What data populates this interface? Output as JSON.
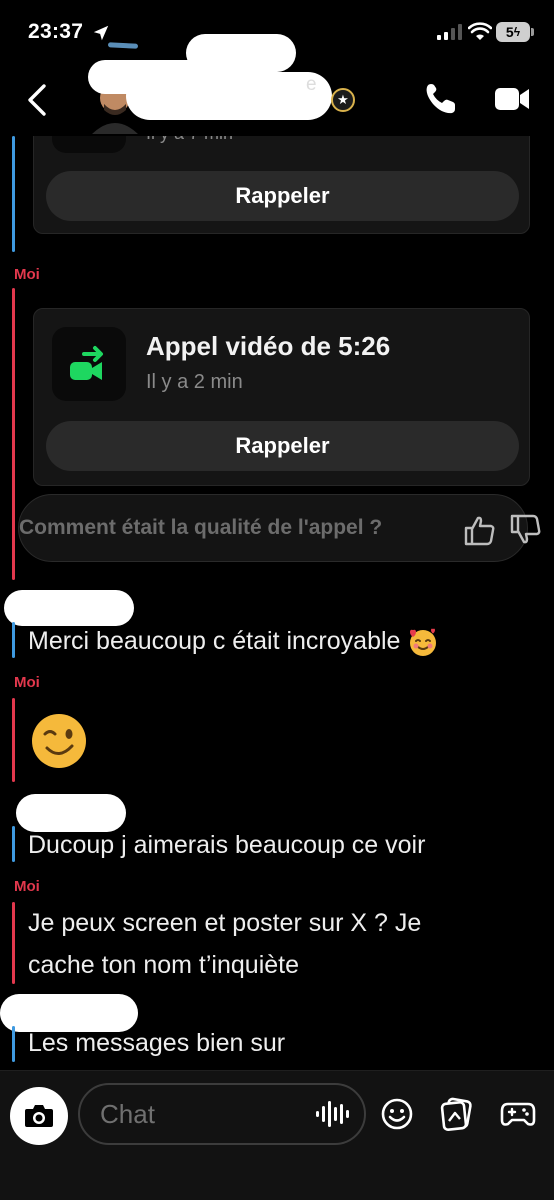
{
  "status_bar": {
    "time": "23:37",
    "battery": "5"
  },
  "header": {
    "name_suffix": "e",
    "icons": {
      "back": "chevron-left-icon",
      "call": "phone-icon",
      "video": "video-camera-icon",
      "badge": "star-badge-icon"
    }
  },
  "chat": {
    "partial_card": {
      "time": "Il y a 7 min",
      "recall_label": "Rappeler"
    },
    "sender_me": "Moi",
    "call_card": {
      "title": "Appel vidéo de 5:26",
      "time": "Il y a 2 min",
      "recall_label": "Rappeler"
    },
    "feedback_prompt": "Comment était la qualité de l'appel ?",
    "messages": [
      {
        "from": "other",
        "text": "Merci beaucoup c était incroyable"
      },
      {
        "from": "me",
        "text": "😉"
      },
      {
        "from": "other",
        "text": "Ducoup j aimerais beaucoup ce voir"
      },
      {
        "from": "me",
        "text_line1": "Je peux screen et poster sur X ? Je",
        "text_line2": "cache ton nom t’inquiète"
      },
      {
        "from": "other",
        "text": "Les messages bien sur"
      }
    ]
  },
  "composer": {
    "placeholder": "Chat"
  },
  "colors": {
    "accent_red": "#e2384d",
    "accent_blue": "#3f9ae0",
    "call_green": "#1ed760"
  }
}
